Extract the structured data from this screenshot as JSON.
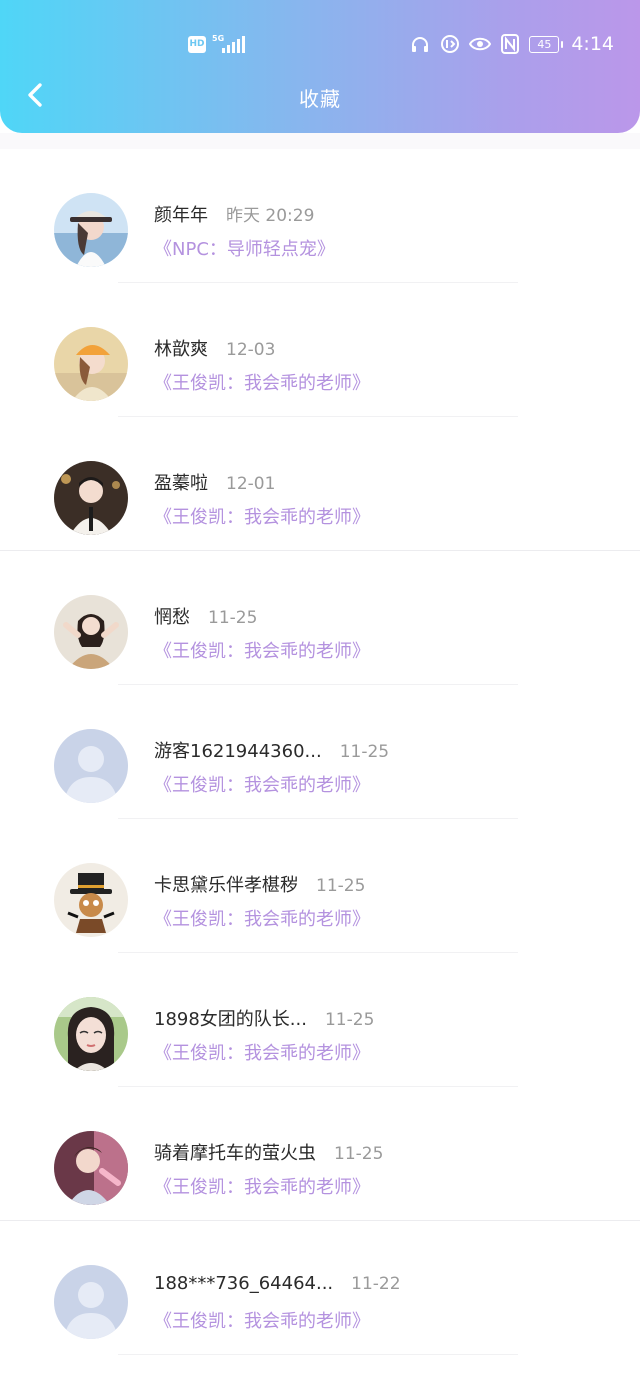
{
  "status_bar": {
    "hd": "HD",
    "network": "5G",
    "battery": "45",
    "time": "4:14"
  },
  "header": {
    "title": "收藏",
    "back_icon": "chevron-left-icon"
  },
  "colors": {
    "header_gradient_start": "#4fd6f7",
    "header_gradient_end": "#bb97ea",
    "story_link": "#b492df",
    "name_text": "#2b2b2b",
    "date_text": "#9a9a9a"
  },
  "favorites": [
    {
      "name": "颜年年",
      "date": "昨天 20:29",
      "story": "《NPC：导师轻点宠》",
      "avatar": "photo-girl-hat"
    },
    {
      "name": "林歆爽",
      "date": "12-03",
      "story": "《王俊凯：我会乖的老师》",
      "avatar": "photo-girl-cap"
    },
    {
      "name": "盈蓁啦",
      "date": "12-01",
      "story": "《王俊凯：我会乖的老师》",
      "avatar": "photo-boy-suit"
    },
    {
      "name": "惘愁",
      "date": "11-25",
      "story": "《王俊凯：我会乖的老师》",
      "avatar": "photo-girl-pose"
    },
    {
      "name": "游客1621944360...",
      "date": "11-25",
      "story": "《王俊凯：我会乖的老师》",
      "avatar": "default-user-icon"
    },
    {
      "name": "卡思黛乐伴孝椹秽",
      "date": "11-25",
      "story": "《王俊凯：我会乖的老师》",
      "avatar": "photo-toy-tophat"
    },
    {
      "name": "1898女团的队长...",
      "date": "11-25",
      "story": "《王俊凯：我会乖的老师》",
      "avatar": "photo-girl-selfie"
    },
    {
      "name": "骑着摩托车的萤火虫",
      "date": "11-25",
      "story": "《王俊凯：我会乖的老师》",
      "avatar": "photo-boy-pink"
    },
    {
      "name": "188***736_64464...",
      "date": "11-22",
      "story": "《王俊凯：我会乖的老师》",
      "avatar": "default-user-icon"
    }
  ]
}
